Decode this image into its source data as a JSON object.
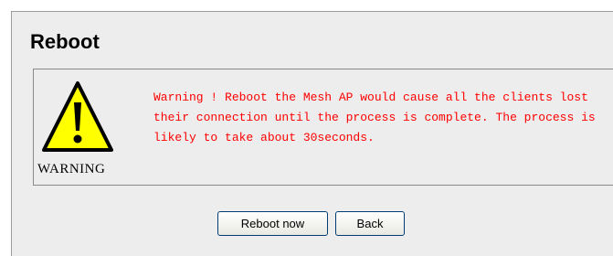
{
  "page": {
    "title": "Reboot"
  },
  "warning": {
    "caption": "WARNING",
    "message": "Warning ! Reboot the Mesh AP would cause all the clients lost their connection until the process is complete. The process is likely to take about 30seconds.",
    "icon": "warning-triangle-icon",
    "text_color": "#ff0000",
    "icon_fill": "#ffff00"
  },
  "buttons": {
    "reboot_label": "Reboot now",
    "back_label": "Back"
  },
  "colors": {
    "panel_background": "#ededed",
    "button_border": "#003c74"
  }
}
